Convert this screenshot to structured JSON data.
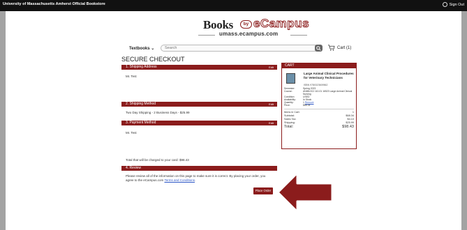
{
  "topbar": {
    "store_name": "University of Massachusetts Amherst Official Bookstore",
    "sign_out": "Sign Out"
  },
  "logo": {
    "books": "Books",
    "by": "by",
    "ecampus": "eCampus",
    "domain": "umass.ecampus.com"
  },
  "nav": {
    "textbooks": "Textbooks",
    "search_placeholder": "Search",
    "cart": "Cart (1)"
  },
  "page_title": "SECURE CHECKOUT",
  "shipping_address": {
    "header": "1. Shipping Address",
    "edit": "Edit",
    "name": "Mr. Test"
  },
  "shipping_method": {
    "header": "2. Shipping Method",
    "edit": "Edit",
    "value": "Two Day Shipping - 2 Business Days - $25.99"
  },
  "payment_method": {
    "header": "3. Payment Method",
    "edit": "Edit",
    "name": "Mr. Test"
  },
  "total_charged": "Total that will be charged to your card: $98.43",
  "review": {
    "header": "4. Review",
    "text": "Please review all of the information on this page to make sure it is correct. By placing your order, you agree to the eCampus.com",
    "terms": "Terms and Conditions",
    "period": "."
  },
  "place_order": "Place Order",
  "cart": {
    "header": "CART",
    "book_title": "Large Animal Clinical Procedures for Veterinary Technicians",
    "isbn": "ISBN 9780323609562",
    "details": [
      {
        "k": "Semester:",
        "v": "Spring 2023"
      },
      {
        "k": "Course:",
        "v": "ANIMLSCI 110-01 16523 Large Animal Clinical Nursing"
      },
      {
        "k": "Condition:",
        "v": "USED"
      },
      {
        "k": "Availability:",
        "v": "In Stock"
      },
      {
        "k": "Quantity:",
        "v": "1"
      },
      {
        "k": "Price:",
        "v": "$68.34"
      }
    ],
    "remove": "Remove",
    "summary": [
      {
        "k": "Items in Cart:",
        "v": "1"
      },
      {
        "k": "Subtotal:",
        "v": "$68.34"
      },
      {
        "k": "Sales Tax:",
        "v": "$4.10"
      },
      {
        "k": "Shipping:",
        "v": "$25.99"
      },
      {
        "k": "Total:",
        "v": "$98.43"
      }
    ]
  },
  "colors": {
    "brand": "#8b1c1c",
    "arrow": "#8b1c1c",
    "link": "#2b55c6"
  }
}
